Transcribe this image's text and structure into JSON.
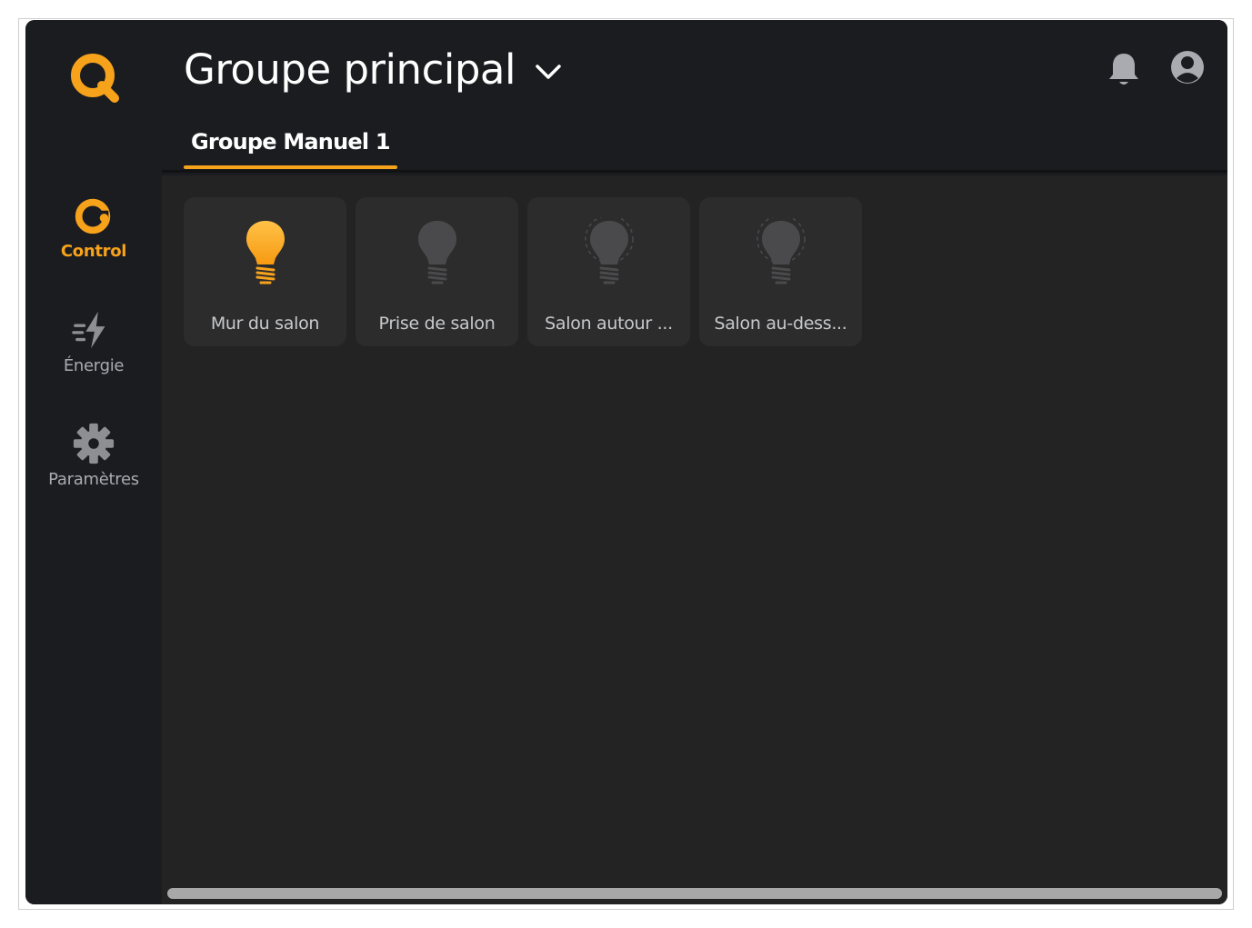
{
  "sidebar": {
    "logo": "q-logo-icon",
    "items": [
      {
        "label": "Control",
        "icon": "control-icon",
        "active": true
      },
      {
        "label": "Énergie",
        "icon": "energy-bolt-icon",
        "active": false
      },
      {
        "label": "Paramètres",
        "icon": "gear-icon",
        "active": false
      }
    ]
  },
  "header": {
    "title": "Groupe principal",
    "tabs": [
      {
        "label": "Groupe Manuel 1",
        "active": true
      }
    ]
  },
  "devices": [
    {
      "name": "Mur du salon",
      "state": "on"
    },
    {
      "name": "Prise de salon",
      "state": "off"
    },
    {
      "name": "Salon autour ...",
      "state": "unavailable"
    },
    {
      "name": "Salon au-dess...",
      "state": "unavailable"
    }
  ],
  "colors": {
    "accent": "#f7a21b",
    "sidebar_bg": "#1b1c20",
    "content_bg": "#232324",
    "card_bg": "#2c2c2d"
  }
}
